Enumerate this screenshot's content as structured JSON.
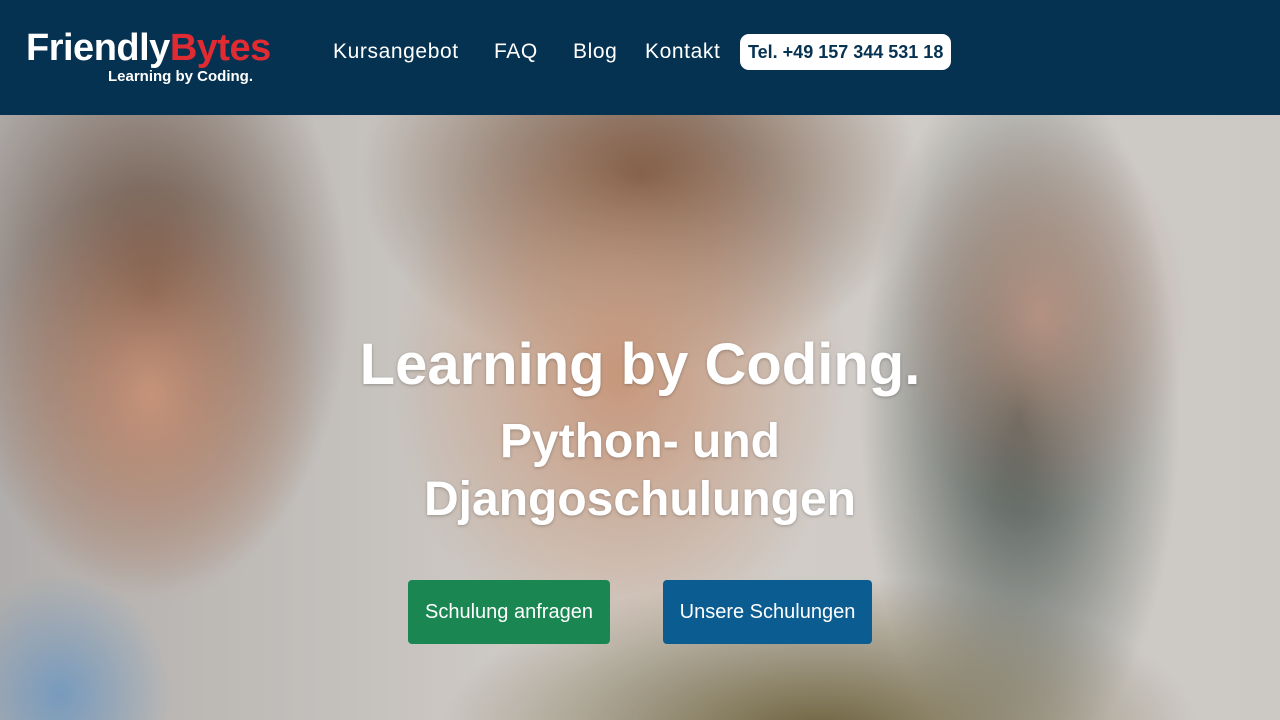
{
  "brand": {
    "name_part1": "Friendly",
    "name_part2": "Bytes",
    "tagline": "Learning by Coding.",
    "color_primary": "#063251",
    "color_accent": "#e02b33"
  },
  "nav": {
    "items": [
      {
        "label": "Kursangebot"
      },
      {
        "label": "FAQ"
      },
      {
        "label": "Blog"
      },
      {
        "label": "Kontakt"
      }
    ],
    "phone": "Tel. +49 157 344 531 18"
  },
  "hero": {
    "title": "Learning by Coding.",
    "subtitle": "Python- und Djangoschulungen",
    "buttons": {
      "request": {
        "label": "Schulung anfragen",
        "color": "#1a8752"
      },
      "courses": {
        "label": "Unsere Schulungen",
        "color": "#0b5c91"
      }
    }
  }
}
